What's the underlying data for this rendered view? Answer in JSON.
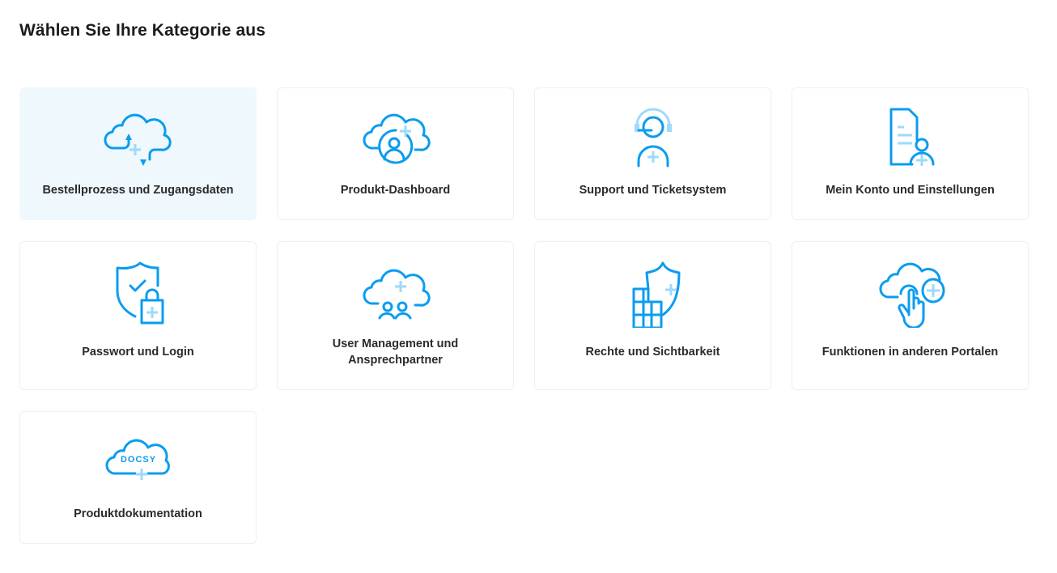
{
  "page": {
    "title": "Wählen Sie Ihre Kategorie aus"
  },
  "colors": {
    "accent": "#0a9cf0",
    "accent_light": "#9fd9fb",
    "selected_bg": "#eef8fd"
  },
  "categories": [
    {
      "label": "Bestellprozess und Zugangsdaten",
      "icon": "cloud-sync-icon",
      "selected": true
    },
    {
      "label": "Produkt-Dashboard",
      "icon": "cloud-user-icon"
    },
    {
      "label": "Support und Ticketsystem",
      "icon": "headset-agent-icon"
    },
    {
      "label": "Mein Konto und Einstellungen",
      "icon": "document-user-icon"
    },
    {
      "label": "Passwort und Login",
      "icon": "shield-lock-icon"
    },
    {
      "label": "User Management und Ansprechpartner",
      "icon": "cloud-users-icon"
    },
    {
      "label": "Rechte und Sichtbarkeit",
      "icon": "building-shield-icon"
    },
    {
      "label": "Funktionen in anderen Portalen",
      "icon": "cloud-touch-icon"
    },
    {
      "label": "Produktdokumentation",
      "icon": "cloud-docsy-icon",
      "logo_text": "DOCSY"
    }
  ]
}
